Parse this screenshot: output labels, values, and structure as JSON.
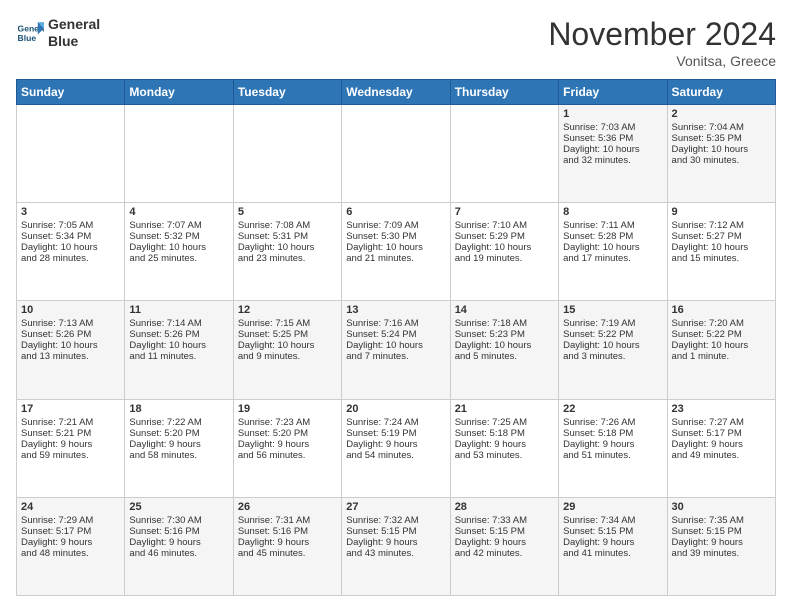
{
  "header": {
    "logo_line1": "General",
    "logo_line2": "Blue",
    "month_title": "November 2024",
    "location": "Vonitsa, Greece"
  },
  "days_of_week": [
    "Sunday",
    "Monday",
    "Tuesday",
    "Wednesday",
    "Thursday",
    "Friday",
    "Saturday"
  ],
  "weeks": [
    [
      {
        "day": "",
        "info": ""
      },
      {
        "day": "",
        "info": ""
      },
      {
        "day": "",
        "info": ""
      },
      {
        "day": "",
        "info": ""
      },
      {
        "day": "",
        "info": ""
      },
      {
        "day": "1",
        "info": "Sunrise: 7:03 AM\nSunset: 5:36 PM\nDaylight: 10 hours\nand 32 minutes."
      },
      {
        "day": "2",
        "info": "Sunrise: 7:04 AM\nSunset: 5:35 PM\nDaylight: 10 hours\nand 30 minutes."
      }
    ],
    [
      {
        "day": "3",
        "info": "Sunrise: 7:05 AM\nSunset: 5:34 PM\nDaylight: 10 hours\nand 28 minutes."
      },
      {
        "day": "4",
        "info": "Sunrise: 7:07 AM\nSunset: 5:32 PM\nDaylight: 10 hours\nand 25 minutes."
      },
      {
        "day": "5",
        "info": "Sunrise: 7:08 AM\nSunset: 5:31 PM\nDaylight: 10 hours\nand 23 minutes."
      },
      {
        "day": "6",
        "info": "Sunrise: 7:09 AM\nSunset: 5:30 PM\nDaylight: 10 hours\nand 21 minutes."
      },
      {
        "day": "7",
        "info": "Sunrise: 7:10 AM\nSunset: 5:29 PM\nDaylight: 10 hours\nand 19 minutes."
      },
      {
        "day": "8",
        "info": "Sunrise: 7:11 AM\nSunset: 5:28 PM\nDaylight: 10 hours\nand 17 minutes."
      },
      {
        "day": "9",
        "info": "Sunrise: 7:12 AM\nSunset: 5:27 PM\nDaylight: 10 hours\nand 15 minutes."
      }
    ],
    [
      {
        "day": "10",
        "info": "Sunrise: 7:13 AM\nSunset: 5:26 PM\nDaylight: 10 hours\nand 13 minutes."
      },
      {
        "day": "11",
        "info": "Sunrise: 7:14 AM\nSunset: 5:26 PM\nDaylight: 10 hours\nand 11 minutes."
      },
      {
        "day": "12",
        "info": "Sunrise: 7:15 AM\nSunset: 5:25 PM\nDaylight: 10 hours\nand 9 minutes."
      },
      {
        "day": "13",
        "info": "Sunrise: 7:16 AM\nSunset: 5:24 PM\nDaylight: 10 hours\nand 7 minutes."
      },
      {
        "day": "14",
        "info": "Sunrise: 7:18 AM\nSunset: 5:23 PM\nDaylight: 10 hours\nand 5 minutes."
      },
      {
        "day": "15",
        "info": "Sunrise: 7:19 AM\nSunset: 5:22 PM\nDaylight: 10 hours\nand 3 minutes."
      },
      {
        "day": "16",
        "info": "Sunrise: 7:20 AM\nSunset: 5:22 PM\nDaylight: 10 hours\nand 1 minute."
      }
    ],
    [
      {
        "day": "17",
        "info": "Sunrise: 7:21 AM\nSunset: 5:21 PM\nDaylight: 9 hours\nand 59 minutes."
      },
      {
        "day": "18",
        "info": "Sunrise: 7:22 AM\nSunset: 5:20 PM\nDaylight: 9 hours\nand 58 minutes."
      },
      {
        "day": "19",
        "info": "Sunrise: 7:23 AM\nSunset: 5:20 PM\nDaylight: 9 hours\nand 56 minutes."
      },
      {
        "day": "20",
        "info": "Sunrise: 7:24 AM\nSunset: 5:19 PM\nDaylight: 9 hours\nand 54 minutes."
      },
      {
        "day": "21",
        "info": "Sunrise: 7:25 AM\nSunset: 5:18 PM\nDaylight: 9 hours\nand 53 minutes."
      },
      {
        "day": "22",
        "info": "Sunrise: 7:26 AM\nSunset: 5:18 PM\nDaylight: 9 hours\nand 51 minutes."
      },
      {
        "day": "23",
        "info": "Sunrise: 7:27 AM\nSunset: 5:17 PM\nDaylight: 9 hours\nand 49 minutes."
      }
    ],
    [
      {
        "day": "24",
        "info": "Sunrise: 7:29 AM\nSunset: 5:17 PM\nDaylight: 9 hours\nand 48 minutes."
      },
      {
        "day": "25",
        "info": "Sunrise: 7:30 AM\nSunset: 5:16 PM\nDaylight: 9 hours\nand 46 minutes."
      },
      {
        "day": "26",
        "info": "Sunrise: 7:31 AM\nSunset: 5:16 PM\nDaylight: 9 hours\nand 45 minutes."
      },
      {
        "day": "27",
        "info": "Sunrise: 7:32 AM\nSunset: 5:15 PM\nDaylight: 9 hours\nand 43 minutes."
      },
      {
        "day": "28",
        "info": "Sunrise: 7:33 AM\nSunset: 5:15 PM\nDaylight: 9 hours\nand 42 minutes."
      },
      {
        "day": "29",
        "info": "Sunrise: 7:34 AM\nSunset: 5:15 PM\nDaylight: 9 hours\nand 41 minutes."
      },
      {
        "day": "30",
        "info": "Sunrise: 7:35 AM\nSunset: 5:15 PM\nDaylight: 9 hours\nand 39 minutes."
      }
    ]
  ]
}
